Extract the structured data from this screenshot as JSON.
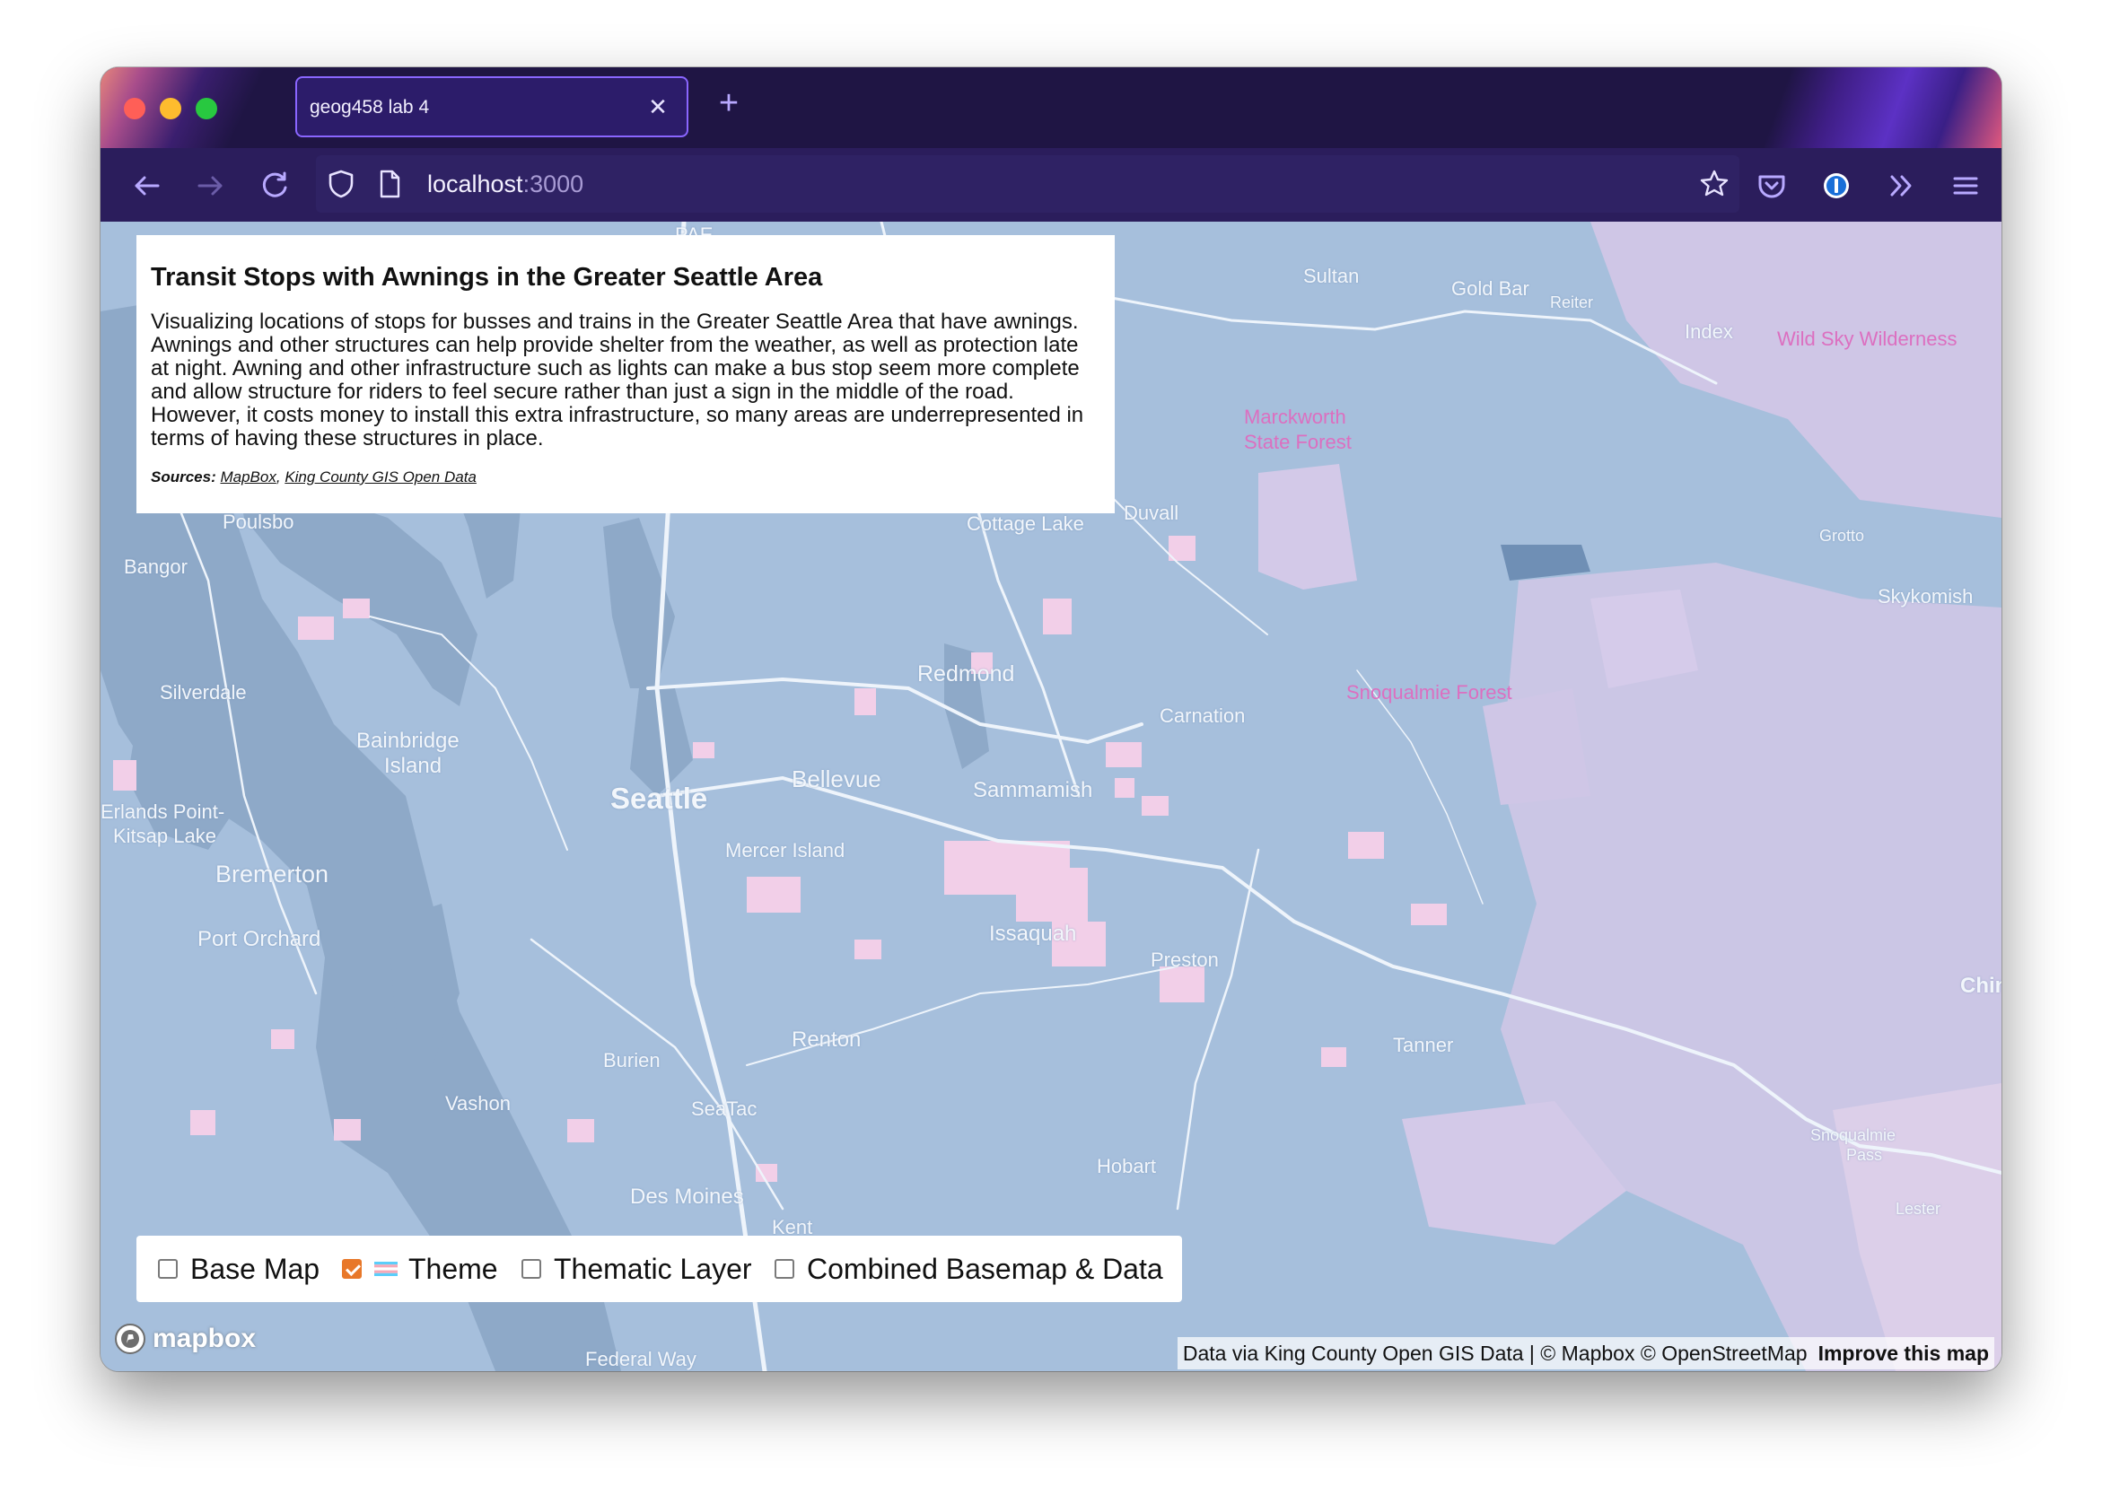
{
  "browser": {
    "tab_title": "geog458 lab 4",
    "url_host": "localhost",
    "url_port": ":3000"
  },
  "info_panel": {
    "title": "Transit Stops with Awnings in the Greater Seattle Area",
    "description": "Visualizing locations of stops for busses and trains in the Greater Seattle Area that have awnings. Awnings and other structures can help provide shelter from the weather, as well as protection late at night. Awning and other infrastructure such as lights can make a bus stop seem more complete and allow structure for riders to feel secure rather than just a sign in the middle of the road. However, it costs money to install this extra infrastructure, so many areas are underrepresented in terms of having these structures in place.",
    "sources_label": "Sources:",
    "source_links": [
      "MapBox",
      "King County GIS Open Data"
    ],
    "source_separator": ", "
  },
  "layer_controls": [
    {
      "label": "Base Map",
      "checked": false
    },
    {
      "label": "Theme",
      "checked": true,
      "icon": "transgender-flag-icon"
    },
    {
      "label": "Thematic Layer",
      "checked": false
    },
    {
      "label": "Combined Basemap & Data",
      "checked": false
    }
  ],
  "map": {
    "place_labels": {
      "pae": "PAE",
      "sultan": "Sultan",
      "gold_bar": "Gold Bar",
      "reiter": "Reiter",
      "index": "Index",
      "wild_sky": "Wild Sky Wilderness",
      "marckworth": "Marckworth",
      "state_forest": "State Forest",
      "poulsbo": "Poulsbo",
      "cottage_lake": "Cottage Lake",
      "duvall": "Duvall",
      "grotto": "Grotto",
      "bangor": "Bangor",
      "skykomish": "Skykomish",
      "redmond": "Redmond",
      "silverdale": "Silverdale",
      "snoqualmie_forest": "Snoqualmie Forest",
      "carnation": "Carnation",
      "bainbridge": "Bainbridge",
      "island": "Island",
      "bellevue": "Bellevue",
      "seattle": "Seattle",
      "sammamish": "Sammamish",
      "erlands_point": "Erlands Point-",
      "kitsap_lake": "Kitsap Lake",
      "mercer_island": "Mercer Island",
      "bremerton": "Bremerton",
      "port_orchard": "Port Orchard",
      "issaquah": "Issaquah",
      "preston": "Preston",
      "chinook": "Chin",
      "renton": "Renton",
      "burien": "Burien",
      "tanner": "Tanner",
      "vashon": "Vashon",
      "seatac": "SeaTac",
      "snoqualmie_pass_1": "Snoqualmie",
      "snoqualmie_pass_2": "Pass",
      "hobart": "Hobart",
      "des_moines": "Des Moines",
      "kent": "Kent",
      "lester": "Lester",
      "federal_way": "Federal Way"
    },
    "colors": {
      "land": "#a6bfdc",
      "water": "#8ea9c8",
      "forest": "#cfc6e6",
      "highlight": "#f2cfe8",
      "roads": "#eef4fb"
    }
  },
  "attribution": {
    "logo_text": "mapbox",
    "text": "Data via King County Open GIS Data | © Mapbox © OpenStreetMap",
    "improve": "Improve this map"
  }
}
